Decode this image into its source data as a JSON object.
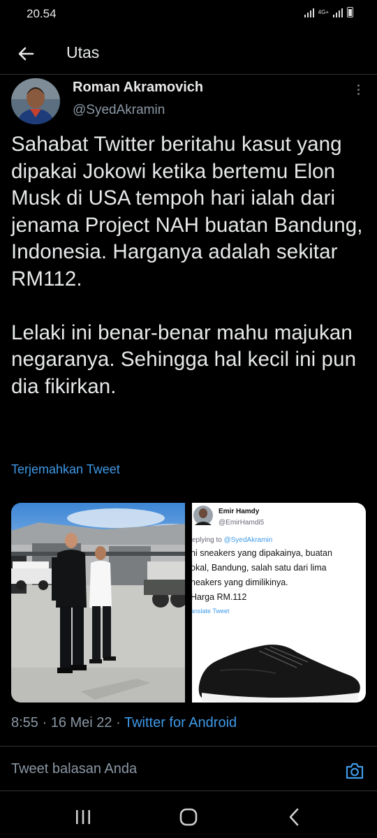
{
  "status_bar": {
    "time": "20.54",
    "network": "4G+"
  },
  "header": {
    "title": "Utas",
    "back_icon": "arrow-left-icon"
  },
  "tweet": {
    "author_name": "Roman Akramovich",
    "author_handle": "@SyedAkramin",
    "paragraph1": "Sahabat Twitter beritahu kasut yang dipakai Jokowi ketika bertemu Elon Musk di USA tempoh hari ialah dari jenama Project NAH buatan Bandung, Indonesia. Harganya adalah sekitar RM112.",
    "paragraph2": "Lelaki ini benar-benar mahu majukan negaranya. Sehingga hal kecil ini pun dia fikirkan.",
    "translate_link": "Terjemahkan Tweet",
    "timestamp": "8:55 · 16 Mei 22 · ",
    "source": "Twitter for Android"
  },
  "embedded_tweet": {
    "name": "Emir Hamdy",
    "handle": "@EmirHamdi5",
    "replying_to_prefix": "eplying to ",
    "replying_to_handle": "@SyedAkramin",
    "line1": "ni sneakers yang dipakainya, buatan",
    "line2": "okal, Bandung, salah satu dari lima",
    "line3": "neakers yang dimilikinya.",
    "line4": "Harga RM.112",
    "translate": "anslate Tweet"
  },
  "reply": {
    "placeholder": "Tweet balasan Anda"
  },
  "colors": {
    "background": "#000000",
    "accent": "#3f9ae8",
    "secondary_text": "#8b98a5",
    "divider": "#2f3336"
  }
}
